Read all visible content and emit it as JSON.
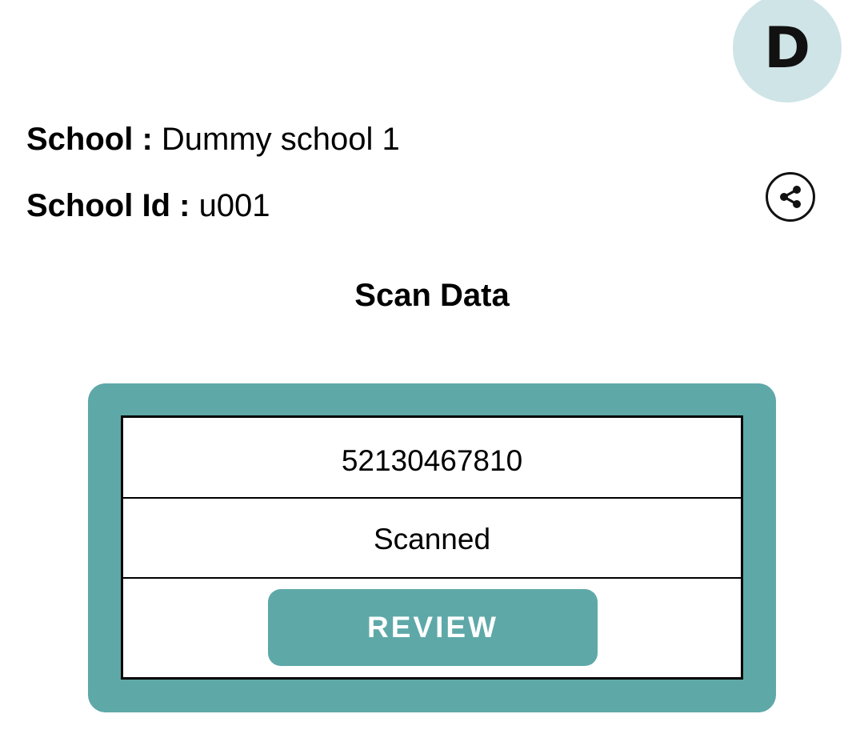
{
  "profile": {
    "avatar_letter": "D"
  },
  "school_info": {
    "school_label": "School  :",
    "school_value": "Dummy school 1",
    "id_label": "School Id :",
    "id_value": "u001"
  },
  "share": {
    "icon": "share-icon"
  },
  "section": {
    "title": "Scan Data"
  },
  "scan_record": {
    "id": "52130467810",
    "status": "Scanned",
    "action_label": "REVIEW"
  },
  "colors": {
    "accent": "#5ea8a8",
    "avatar_bg": "#cfe4e6"
  }
}
